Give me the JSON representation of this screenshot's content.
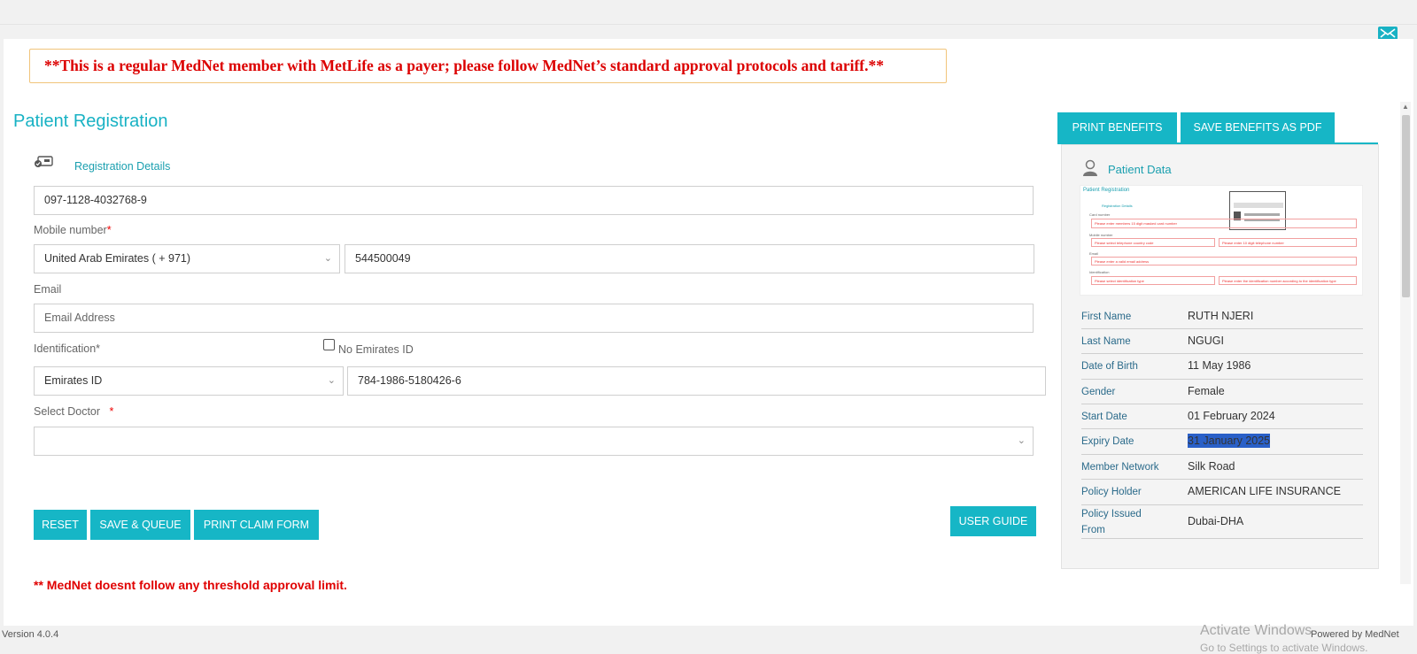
{
  "banner": {
    "text": "**This is a regular MedNet member with MetLife as a payer; please follow MedNet’s standard approval protocols and tariff.**"
  },
  "page_title": "Patient Registration",
  "registration": {
    "section_label": "Registration Details",
    "card_number": "097-1128-4032768-9",
    "mobile_label": "Mobile number",
    "mobile_required": "*",
    "country_code": "United Arab Emirates ( + 971)",
    "mobile_number": "544500049",
    "email_label": "Email",
    "email_placeholder": "Email Address",
    "identification_label": "Identification*",
    "no_eid_label": "No Emirates ID",
    "id_type": "Emirates ID",
    "id_number": "784-1986-5180426-6",
    "doctor_label": "Select Doctor",
    "doctor_required": "*",
    "doctor_value": ""
  },
  "buttons": {
    "reset": "RESET",
    "save_queue": "SAVE & QUEUE",
    "print_claim": "PRINT CLAIM FORM",
    "user_guide": "USER GUIDE",
    "print_benefits": "PRINT BENEFITS",
    "save_benefits_pdf": "SAVE BENEFITS AS PDF"
  },
  "note": "** MedNet doesnt follow any threshold approval limit.",
  "patient_data": {
    "title": "Patient Data",
    "thumbnail": {
      "title": "Patient Registration",
      "section": "Registration Details",
      "card_label": "Card number",
      "card_hint": "Please enter members 15 digit masked card number",
      "mobile_label": "Mobile number",
      "mobile_hint1": "Please select telephone country code",
      "mobile_hint2": "Please enter 10 digit telephone number",
      "email_label": "Email",
      "email_hint": "Please enter a valid email address",
      "id_label": "Identification",
      "id_hint1": "Please select identification type",
      "id_hint2": "Please enter the identification number according to the identification type"
    },
    "rows": [
      {
        "key": "First Name",
        "value": "RUTH NJERI"
      },
      {
        "key": "Last Name",
        "value": "NGUGI"
      },
      {
        "key": "Date of Birth",
        "value": "11 May 1986"
      },
      {
        "key": "Gender",
        "value": "Female"
      },
      {
        "key": "Start Date",
        "value": "01 February 2024"
      },
      {
        "key": "Expiry Date",
        "value": "31 January 2025"
      },
      {
        "key": "Member Network",
        "value": "Silk Road"
      },
      {
        "key": "Policy Holder",
        "value": "AMERICAN LIFE INSURANCE"
      },
      {
        "key": "Policy Issued From",
        "value": "Dubai-DHA"
      }
    ]
  },
  "watermark": {
    "line1": "Activate Windows",
    "line2": "Go to Settings to activate Windows."
  },
  "footer": {
    "left": "Version 4.0.4",
    "right": "Powered by MedNet"
  },
  "colors": {
    "accent": "#16b6c6",
    "alert": "#e00000",
    "highlight": "#2a60c8"
  }
}
